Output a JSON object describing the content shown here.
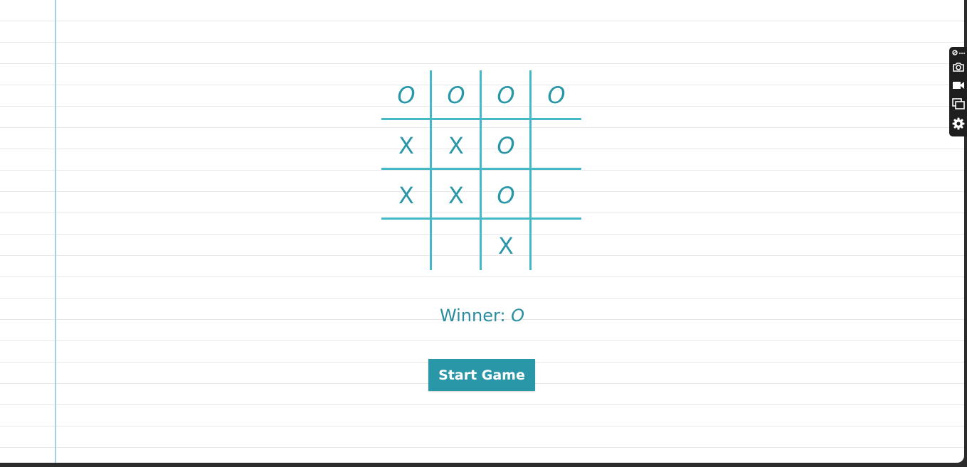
{
  "board": {
    "cells": [
      [
        "O",
        "O",
        "O",
        "O"
      ],
      [
        "X",
        "X",
        "O",
        ""
      ],
      [
        "X",
        "X",
        "O",
        ""
      ],
      [
        "",
        "",
        "X",
        ""
      ]
    ]
  },
  "status": {
    "label": "Winner:",
    "value": "O"
  },
  "start_button": {
    "label": "Start Game"
  },
  "colors": {
    "mark": "#2a97a8",
    "grid": "#46b9c9",
    "button": "#2a97a8",
    "notebook_line": "#e6e8ea",
    "margin_line": "#a9cfdc"
  },
  "toolbar": {
    "icons": [
      "pin-icon",
      "camera-icon",
      "video-icon",
      "windows-icon",
      "gear-icon"
    ]
  }
}
